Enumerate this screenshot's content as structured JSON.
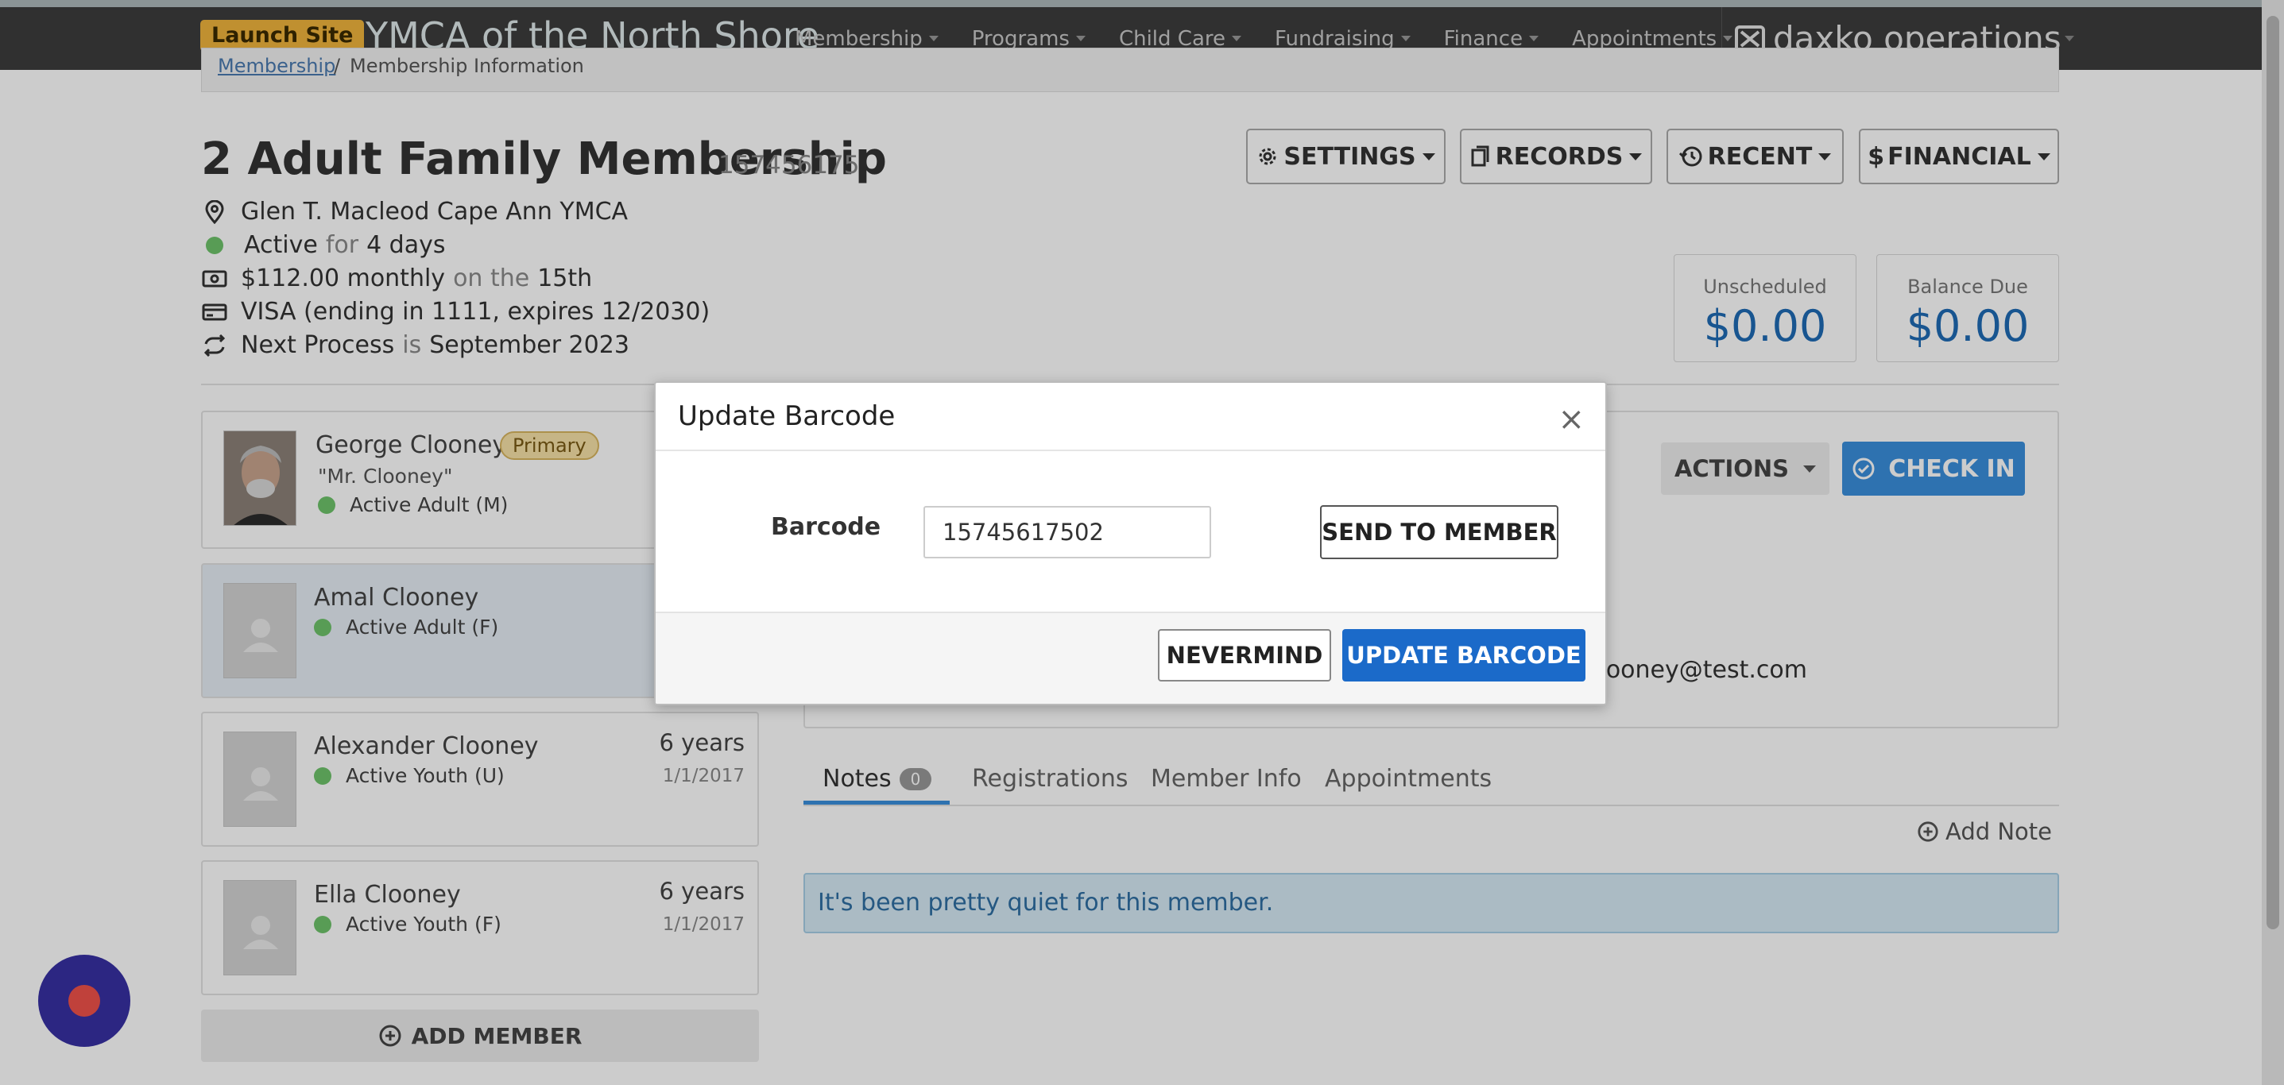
{
  "topnav": {
    "launch_label": "Launch Site",
    "org_title": "YMCA of the North Shore",
    "items": [
      "Membership",
      "Programs",
      "Child Care",
      "Fundraising",
      "Finance",
      "Appointments"
    ],
    "brand": "daxko operations"
  },
  "breadcrumb": {
    "parent": "Membership",
    "separator": "/",
    "current": "Membership Information"
  },
  "membership": {
    "title": "2 Adult Family Membership",
    "id": "157456175",
    "branch": "Glen T. Macleod Cape Ann YMCA",
    "status": "Active",
    "status_for": "for",
    "status_duration": "4 days",
    "fee": "$112.00 monthly",
    "fee_on": "on the",
    "fee_day": "15th",
    "payment": "VISA (ending in 1111, expires 12/2030)",
    "next_label": "Next Process",
    "next_is": "is",
    "next_date": "September 2023"
  },
  "header_buttons": {
    "settings": "SETTINGS",
    "records": "RECORDS",
    "recent": "RECENT",
    "financial": "FINANCIAL"
  },
  "balances": {
    "unscheduled_label": "Unscheduled",
    "unscheduled": "$0.00",
    "balance_due_label": "Balance Due",
    "balance_due": "$0.00"
  },
  "members": [
    {
      "name": "George Clooney",
      "badge": "Primary",
      "nickname": "\"Mr. Clooney\"",
      "status": "Active Adult (M)",
      "age": "",
      "dob": ""
    },
    {
      "name": "Amal Clooney",
      "badge": "",
      "nickname": "",
      "status": "Active Adult (F)",
      "age": "",
      "dob": ""
    },
    {
      "name": "Alexander Clooney",
      "badge": "",
      "nickname": "",
      "status": "Active Youth (U)",
      "age": "6 years",
      "dob": "1/1/2017"
    },
    {
      "name": "Ella Clooney",
      "badge": "",
      "nickname": "",
      "status": "Active Youth (F)",
      "age": "6 years",
      "dob": "1/1/2017"
    }
  ],
  "add_member_label": "ADD MEMBER",
  "detail": {
    "actions_label": "ACTIONS",
    "checkin_label": "CHECK IN",
    "email_fragment": "clooney@test.com"
  },
  "tabs": [
    {
      "label": "Notes",
      "count": "0"
    },
    {
      "label": "Registrations"
    },
    {
      "label": "Member Info"
    },
    {
      "label": "Appointments"
    }
  ],
  "add_note_label": "Add Note",
  "empty_message": "It's been pretty quiet for this member.",
  "modal": {
    "title": "Update Barcode",
    "close": "×",
    "barcode_label": "Barcode",
    "barcode_value": "15745617502",
    "send_label": "SEND TO MEMBER",
    "nevermind_label": "NEVERMIND",
    "update_label": "UPDATE BARCODE"
  },
  "colors": {
    "accent": "#1b6ac9",
    "checkin": "#3a8fdc",
    "nav_bg": "#3d3d3d",
    "launch": "#f0b43d",
    "status_active": "#6ec36b",
    "money": "#1f6bb5"
  }
}
